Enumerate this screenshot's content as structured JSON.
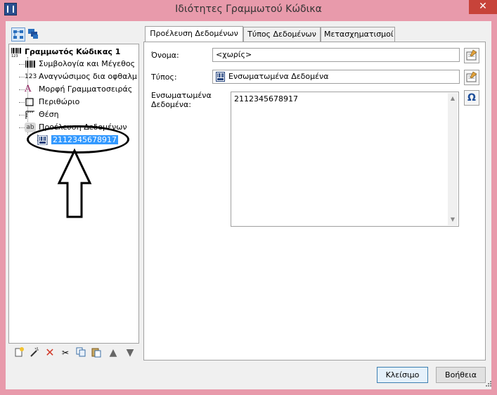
{
  "window": {
    "title": "Ιδιότητες Γραμμωτού Κώδικα",
    "close_glyph": "✕"
  },
  "tree": {
    "root": {
      "label": "Γραμμωτός Κώδικας 1",
      "icon": "barcode-icon"
    },
    "items": [
      {
        "label": "Συμβολογία και Μέγεθος",
        "icon": "barcode-lines-icon"
      },
      {
        "label": "Αναγνώσιμος δια οφθαλμ",
        "icon": "digits-123-icon",
        "icon_text": "123"
      },
      {
        "label": "Μορφή Γραμματοσειράς",
        "icon": "font-icon",
        "icon_text": "A"
      },
      {
        "label": "Περιθώριο",
        "icon": "margin-box-icon"
      },
      {
        "label": "Θέση",
        "icon": "position-icon"
      },
      {
        "label": "Προέλευση Δεδομένων",
        "icon": "data-source-icon",
        "icon_text": "ab"
      }
    ],
    "selected_child": {
      "label": "2112345678917",
      "icon": "embedded-data-icon"
    }
  },
  "tabs": [
    {
      "label": "Προέλευση Δεδομένων",
      "active": true
    },
    {
      "label": "Τύπος Δεδομένων",
      "active": false
    },
    {
      "label": "Μετασχηματισμοί",
      "active": false
    }
  ],
  "form": {
    "name_label": "Όνομα:",
    "name_value": "<χωρίς>",
    "type_label": "Τύπος:",
    "type_value": "Ενσωματωμένα Δεδομένα",
    "embedded_label_line1": "Ενσωματωμένα",
    "embedded_label_line2": "Δεδομένα:",
    "embedded_value": "2112345678917",
    "omega_glyph": "Ω"
  },
  "buttons": {
    "close_label": "Κλείσιμο",
    "help_label": "Βοήθεια"
  },
  "colors": {
    "titlebar": "#e89aab",
    "selection": "#3399ff",
    "close": "#c7433a"
  }
}
